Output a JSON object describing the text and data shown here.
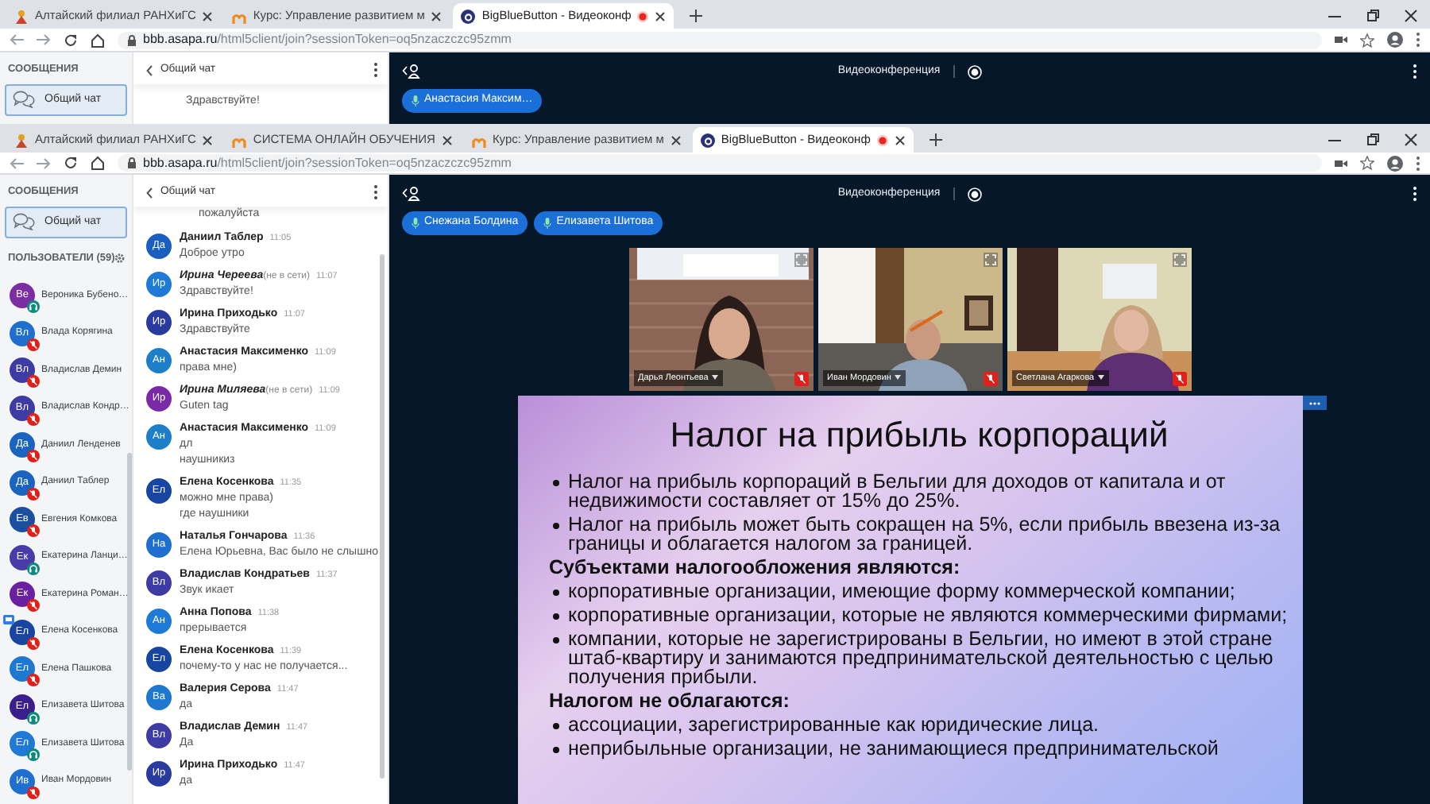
{
  "back_window": {
    "tabs": [
      {
        "title": "Алтайский филиал РАНХиГС",
        "kind": "site",
        "selected": false,
        "recording": false
      },
      {
        "title": "Курс: Управление развитием м",
        "kind": "course",
        "selected": false,
        "recording": false
      },
      {
        "title": "BigBlueButton - Видеоконф",
        "kind": "conference",
        "selected": true,
        "recording": true
      }
    ],
    "url": {
      "host": "bbb.asapa.ru",
      "path": "/html5client/join?sessionToken=oq5nzaczczc95zmm"
    },
    "sidebar": {
      "heading": "СООБЩЕНИЯ",
      "chat_item": {
        "label": "Общий чат",
        "selected": true
      }
    },
    "chat": {
      "title": "Общий чат",
      "visible_line": "Здравствуйте!"
    },
    "main": {
      "title": "Видеоконференция",
      "talkers": [
        "Анастасия Максим…"
      ]
    }
  },
  "front_window": {
    "tabs": [
      {
        "title": "Алтайский филиал РАНХиГС",
        "kind": "site",
        "selected": false,
        "recording": false
      },
      {
        "title": "СИСТЕМА ОНЛАЙН ОБУЧЕНИЯ",
        "kind": "course",
        "selected": false,
        "recording": false
      },
      {
        "title": "Курс: Управление развитием м",
        "kind": "course",
        "selected": false,
        "recording": false
      },
      {
        "title": "BigBlueButton - Видеоконф",
        "kind": "conference",
        "selected": true,
        "recording": true
      }
    ],
    "url": {
      "host": "bbb.asapa.ru",
      "path": "/html5client/join?sessionToken=oq5nzaczczc95zmm"
    },
    "sidebar": {
      "heading": "СООБЩЕНИЯ",
      "chat_item": {
        "label": "Общий чат",
        "selected": true
      },
      "users_heading": "ПОЛЬЗОВАТЕЛИ (59)",
      "users": [
        {
          "initials": "Ве",
          "name": "Вероника Бубено…",
          "color": "#7b2ea3",
          "muted": false,
          "presenter": false
        },
        {
          "initials": "Вл",
          "name": "Влада Корягина",
          "color": "#1e6fd0",
          "muted": true,
          "presenter": false
        },
        {
          "initials": "Вл",
          "name": "Владислав Демин",
          "color": "#3d3ba4",
          "muted": true,
          "presenter": false
        },
        {
          "initials": "Вл",
          "name": "Владислав Кондр…",
          "color": "#3d3ba4",
          "muted": true,
          "presenter": false
        },
        {
          "initials": "Да",
          "name": "Даниил Ленденев",
          "color": "#1a64c0",
          "muted": true,
          "presenter": false
        },
        {
          "initials": "Да",
          "name": "Даниил Таблер",
          "color": "#1a64c0",
          "muted": true,
          "presenter": false
        },
        {
          "initials": "Ев",
          "name": "Евгения Комкова",
          "color": "#1b4fa0",
          "muted": true,
          "presenter": false
        },
        {
          "initials": "Ек",
          "name": "Екатерина Ланци…",
          "color": "#4a3ca8",
          "muted": false,
          "presenter": false
        },
        {
          "initials": "Ек",
          "name": "Екатерина Роман…",
          "color": "#6a1fa0",
          "muted": true,
          "presenter": false
        },
        {
          "initials": "Ел",
          "name": "Елена Косенкова",
          "color": "#1745a0",
          "muted": true,
          "presenter": true
        },
        {
          "initials": "Ел",
          "name": "Елена Пашкова",
          "color": "#1f78d0",
          "muted": true,
          "presenter": false
        },
        {
          "initials": "Ел",
          "name": "Елизавета Шитова",
          "color": "#3a1e8c",
          "muted": false,
          "presenter": false
        },
        {
          "initials": "Ел",
          "name": "Елизавета Шитова",
          "color": "#1f7ad6",
          "muted": false,
          "presenter": false
        },
        {
          "initials": "Ив",
          "name": "Иван Мордовин",
          "color": "#1f6fd0",
          "muted": true,
          "presenter": false
        }
      ]
    },
    "chat": {
      "title": "Общий чат",
      "messages": [
        {
          "kind": "continuation",
          "lines": [
            "пожалуйста"
          ]
        },
        {
          "kind": "message",
          "initials": "Да",
          "color": "#1a5fbf",
          "name": "Даниил Таблер",
          "offline": false,
          "time": "11:05",
          "lines": [
            "Доброе утро"
          ]
        },
        {
          "kind": "message",
          "initials": "Ир",
          "color": "#1e7ad6",
          "name": "Ирина Череева",
          "offline": true,
          "note": "(не в сети)",
          "time": "11:07",
          "lines": [
            "Здравствуйте!"
          ]
        },
        {
          "kind": "message",
          "initials": "Ир",
          "color": "#2a3ba0",
          "name": "Ирина Приходько",
          "offline": false,
          "time": "11:07",
          "lines": [
            "Здравствуйте"
          ]
        },
        {
          "kind": "message",
          "initials": "Ан",
          "color": "#1d7fc8",
          "name": "Анастасия Максименко",
          "offline": false,
          "time": "11:09",
          "lines": [
            "права мне)"
          ]
        },
        {
          "kind": "message",
          "initials": "Ир",
          "color": "#7a2aa6",
          "name": "Ирина Миляева",
          "offline": true,
          "note": "(не в сети)",
          "time": "11:09",
          "lines": [
            "Guten tag"
          ]
        },
        {
          "kind": "message",
          "initials": "Ан",
          "color": "#1d7fc8",
          "name": "Анастасия Максименко",
          "offline": false,
          "time": "11:09",
          "lines": [
            "дл",
            "наушникиз"
          ]
        },
        {
          "kind": "message",
          "initials": "Ел",
          "color": "#1745a0",
          "name": "Елена Косенкова",
          "offline": false,
          "time": "11:35",
          "lines": [
            "можно мне права)",
            "где наушники"
          ]
        },
        {
          "kind": "message",
          "initials": "На",
          "color": "#1f6fd0",
          "name": "Наталья Гончарова",
          "offline": false,
          "time": "11:36",
          "lines": [
            "Елена Юрьевна, Вас было не слышно"
          ]
        },
        {
          "kind": "message",
          "initials": "Вл",
          "color": "#3d3ba4",
          "name": "Владислав Кондратьев",
          "offline": false,
          "time": "11:37",
          "lines": [
            "Звук икает"
          ]
        },
        {
          "kind": "message",
          "initials": "Ан",
          "color": "#1f7ad6",
          "name": "Анна Попова",
          "offline": false,
          "time": "11:38",
          "lines": [
            "прерывается"
          ]
        },
        {
          "kind": "message",
          "initials": "Ел",
          "color": "#1745a0",
          "name": "Елена Косенкова",
          "offline": false,
          "time": "11:39",
          "lines": [
            "почему-то у нас не получается..."
          ]
        },
        {
          "kind": "message",
          "initials": "Ва",
          "color": "#1f78d0",
          "name": "Валерия Серова",
          "offline": false,
          "time": "11:47",
          "lines": [
            "да"
          ]
        },
        {
          "kind": "message",
          "initials": "Вл",
          "color": "#3d3ba4",
          "name": "Владислав Демин",
          "offline": false,
          "time": "11:47",
          "lines": [
            "Да"
          ]
        },
        {
          "kind": "message",
          "initials": "Ир",
          "color": "#2a3ba0",
          "name": "Ирина Приходько",
          "offline": false,
          "time": "11:47",
          "lines": [
            "да"
          ]
        }
      ]
    },
    "main": {
      "title": "Видеоконференция",
      "talkers": [
        "Снежана Болдина",
        "Елизавета Шитова"
      ],
      "videos": [
        {
          "name": "Дарья Леонтьева",
          "muted": true
        },
        {
          "name": "Иван Мордовин",
          "muted": true
        },
        {
          "name": "Светлана Агаркова",
          "muted": true
        }
      ],
      "slide": {
        "title": "Налог на прибыль корпораций",
        "items": [
          {
            "kind": "bullet",
            "text": "Налог на прибыль корпораций в Бельгии для доходов от капитала и от недвижимости составляет от 15% до 25%."
          },
          {
            "kind": "bullet",
            "text": "Налог на прибыль может быть сокращен на 5%, если прибыль ввезена из-за границы и облагается налогом за границей."
          },
          {
            "kind": "heading",
            "text": "Субъектами налогообложения являются:"
          },
          {
            "kind": "bullet",
            "text": "корпоративные организации, имеющие форму коммерческой компании;"
          },
          {
            "kind": "bullet",
            "text": "корпоративные организации, которые не являются коммерческими фирмами;"
          },
          {
            "kind": "bullet",
            "text": "компании, которые не зарегистрированы в Бельгии, но имеют в этой стране штаб-квартиру и занимаются предпринимательской деятельностью с целью получения прибыли."
          },
          {
            "kind": "heading",
            "text": "Налогом не облагаются:"
          },
          {
            "kind": "bullet",
            "text": "ассоциации, зарегистрированные как юридические лица."
          },
          {
            "kind": "bullet",
            "text": "неприбыльные организации, не занимающиеся предпринимательской"
          }
        ]
      }
    }
  }
}
